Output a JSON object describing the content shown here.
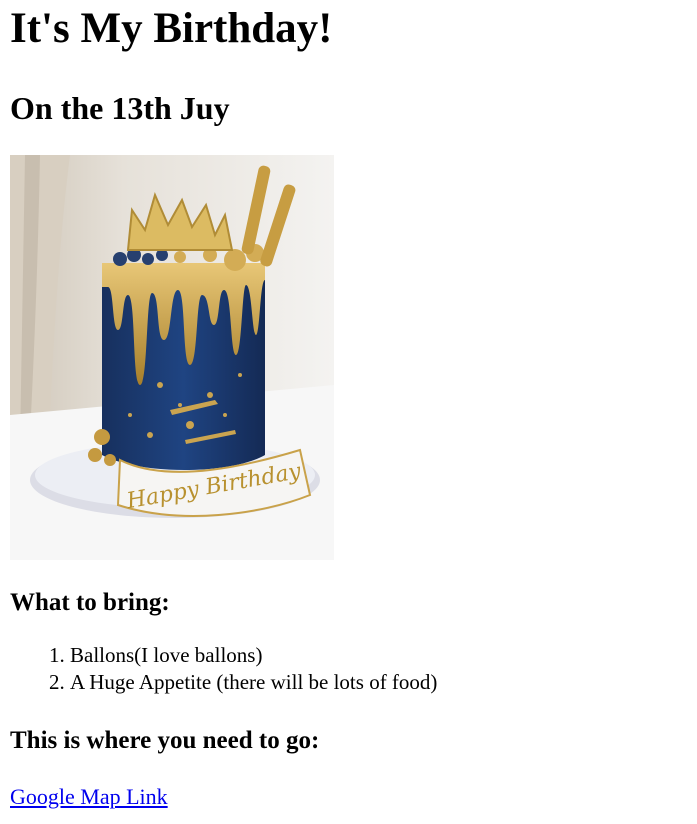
{
  "title": "It's My Birthday!",
  "date_heading": "On the 13th Juy",
  "image": {
    "description_icon": "birthday-cake-image",
    "topper_text": "Happy Birthday"
  },
  "bring_heading": "What to bring:",
  "bring_items": [
    "Ballons(I love ballons)",
    "A Huge Appetite (there will be lots of food)"
  ],
  "location_heading": "This is where you need to go:",
  "map_link_label": "Google Map Link",
  "colors": {
    "link": "#0000ee",
    "cake_blue": "#1f3f78",
    "gold": "#c9a24a"
  }
}
